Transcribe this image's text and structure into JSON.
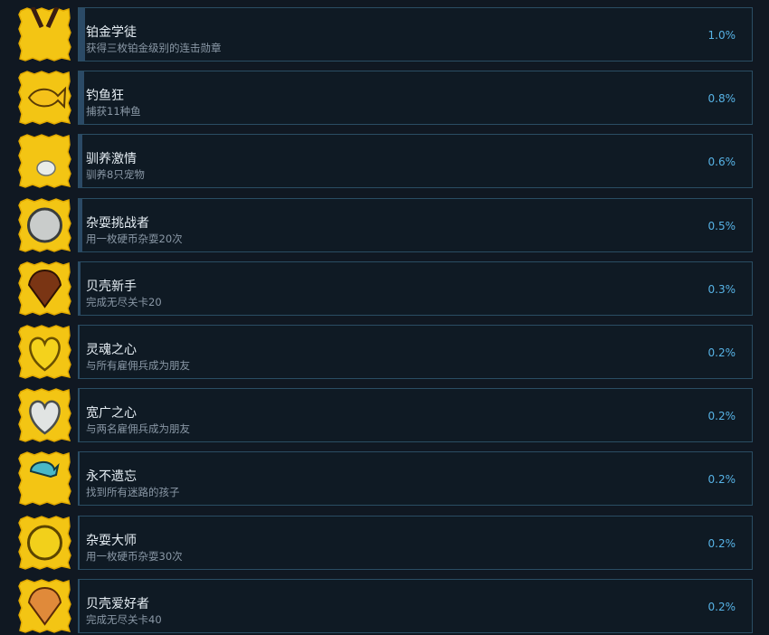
{
  "achievements": [
    {
      "name": "铂金学徒",
      "desc": "获得三枚铂金级别的连击勋章",
      "percent": "1.0%",
      "progress": 0.01,
      "icon": "platinum-medal-icon"
    },
    {
      "name": "钓鱼狂",
      "desc": "捕获11种鱼",
      "percent": "0.8%",
      "progress": 0.008,
      "icon": "fish-icon"
    },
    {
      "name": "驯养激情",
      "desc": "驯养8只宠物",
      "percent": "0.6%",
      "progress": 0.006,
      "icon": "paw-icon"
    },
    {
      "name": "杂耍挑战者",
      "desc": "用一枚硬币杂耍20次",
      "percent": "0.5%",
      "progress": 0.005,
      "icon": "silver-coin-icon"
    },
    {
      "name": "贝壳新手",
      "desc": "完成无尽关卡20",
      "percent": "0.3%",
      "progress": 0.003,
      "icon": "dark-shell-icon"
    },
    {
      "name": "灵魂之心",
      "desc": "与所有雇佣兵成为朋友",
      "percent": "0.2%",
      "progress": 0.002,
      "icon": "gold-heart-icon"
    },
    {
      "name": "宽广之心",
      "desc": "与两名雇佣兵成为朋友",
      "percent": "0.2%",
      "progress": 0.002,
      "icon": "silver-heart-icon"
    },
    {
      "name": "永不遗忘",
      "desc": "找到所有迷路的孩子",
      "percent": "0.2%",
      "progress": 0.002,
      "icon": "child-icon"
    },
    {
      "name": "杂耍大师",
      "desc": "用一枚硬币杂耍30次",
      "percent": "0.2%",
      "progress": 0.002,
      "icon": "gold-coin-icon"
    },
    {
      "name": "贝壳爱好者",
      "desc": "完成无尽关卡40",
      "percent": "0.2%",
      "progress": 0.002,
      "icon": "orange-shell-icon"
    }
  ],
  "colors": {
    "icon_bg": "#f3c514",
    "icon_border": "#e0a800",
    "card_border": "#2a4d63",
    "percent": "#57b3e6"
  }
}
